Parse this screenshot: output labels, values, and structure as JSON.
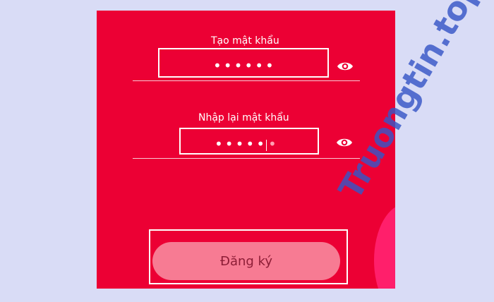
{
  "form": {
    "password": {
      "label": "Tạo mật khẩu",
      "masked_value": "••••••"
    },
    "confirm_password": {
      "label": "Nhập lại mật khẩu",
      "masked_value": "•••••",
      "pending_char": "•"
    },
    "submit_label": "Đăng ký"
  },
  "watermark": {
    "text": "Truongtin.top"
  },
  "colors": {
    "background": "#d9dcf6",
    "panel": "#ec0034",
    "button": "#f77b93",
    "button_text": "#8d1d36"
  },
  "icons": {
    "visibility": "eye-icon"
  }
}
